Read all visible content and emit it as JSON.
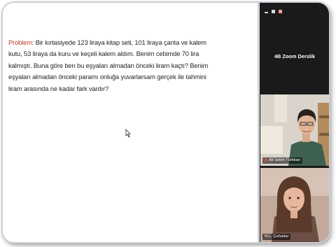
{
  "slide": {
    "problem_label": "Problem",
    "problem_text": ": Bir kırtasiyede 123 liraya kitap seti, 101 liraya çanta ve kalem kutu, 53 liraya da kuru ve keçeli kalem aldım. Benim cebimde 70 lira kalmıştı. Buna göre ben bu eşyaları almadan önceki liram kaçtı? Benim eşyaları almadan önceki paramı onluğa yuvarlarsam gerçek ile tahmini liram arasında ne kadar fark vardır?"
  },
  "zoom": {
    "meeting_title": "4B Zoom Derslik",
    "participants": [
      {
        "name": "Ali Selim Türkkan"
      },
      {
        "name": "N.L. Çuhadar"
      }
    ]
  },
  "colors": {
    "problem_label": "#c0392b",
    "panel_bg": "#1a1a1a",
    "text": "#262626"
  }
}
